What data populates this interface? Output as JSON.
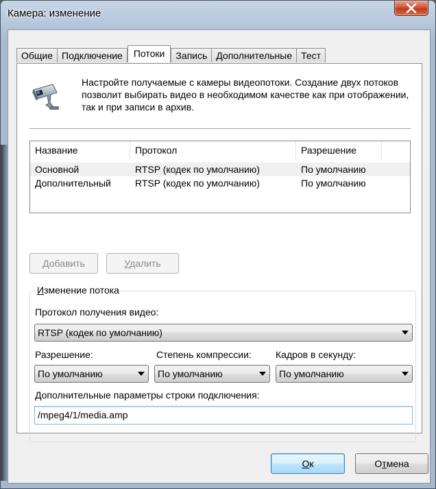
{
  "window": {
    "title": "Камера: изменение"
  },
  "tabs": [
    "Общие",
    "Подключение",
    "Потоки",
    "Запись",
    "Дополнительные",
    "Тест"
  ],
  "active_tab": "Потоки",
  "intro_text": "Настройте получаемые с камеры видеопотоки. Создание двух потоков позволит выбирать видео в необходимом качестве как при отображении, так и при записи в архив.",
  "streams": {
    "columns": [
      "Название",
      "Протокол",
      "Разрешение"
    ],
    "rows": [
      [
        "Основной",
        "RTSP (кодек по умолчанию)",
        "По умолчанию"
      ],
      [
        "Дополнительный",
        "RTSP (кодек по умолчанию)",
        "По умолчанию"
      ]
    ]
  },
  "buttons": {
    "add_mnemonic": "Д",
    "add_rest": "обавить",
    "delete_mnemonic": "У",
    "delete_rest": "далить",
    "ok_mnemonic": "О",
    "ok_rest": "к",
    "cancel_pre": "О",
    "cancel_mnemonic": "т",
    "cancel_rest": "мена"
  },
  "group": {
    "title_mnemonic": "И",
    "title_rest": "зменение потока",
    "protocol_label": "Протокол получения видео:",
    "protocol_value": "RTSP (кодек по умолчанию)",
    "resolution_label": "Разрешение:",
    "resolution_value": "По умолчанию",
    "compression_label": "Степень компрессии:",
    "compression_value": "По умолчанию",
    "fps_label": "Кадров в секунду:",
    "fps_value": "По умолчанию",
    "params_label": "Дополнительные параметры строки подключения:",
    "params_value": "/mpeg4/1/media.amp"
  }
}
